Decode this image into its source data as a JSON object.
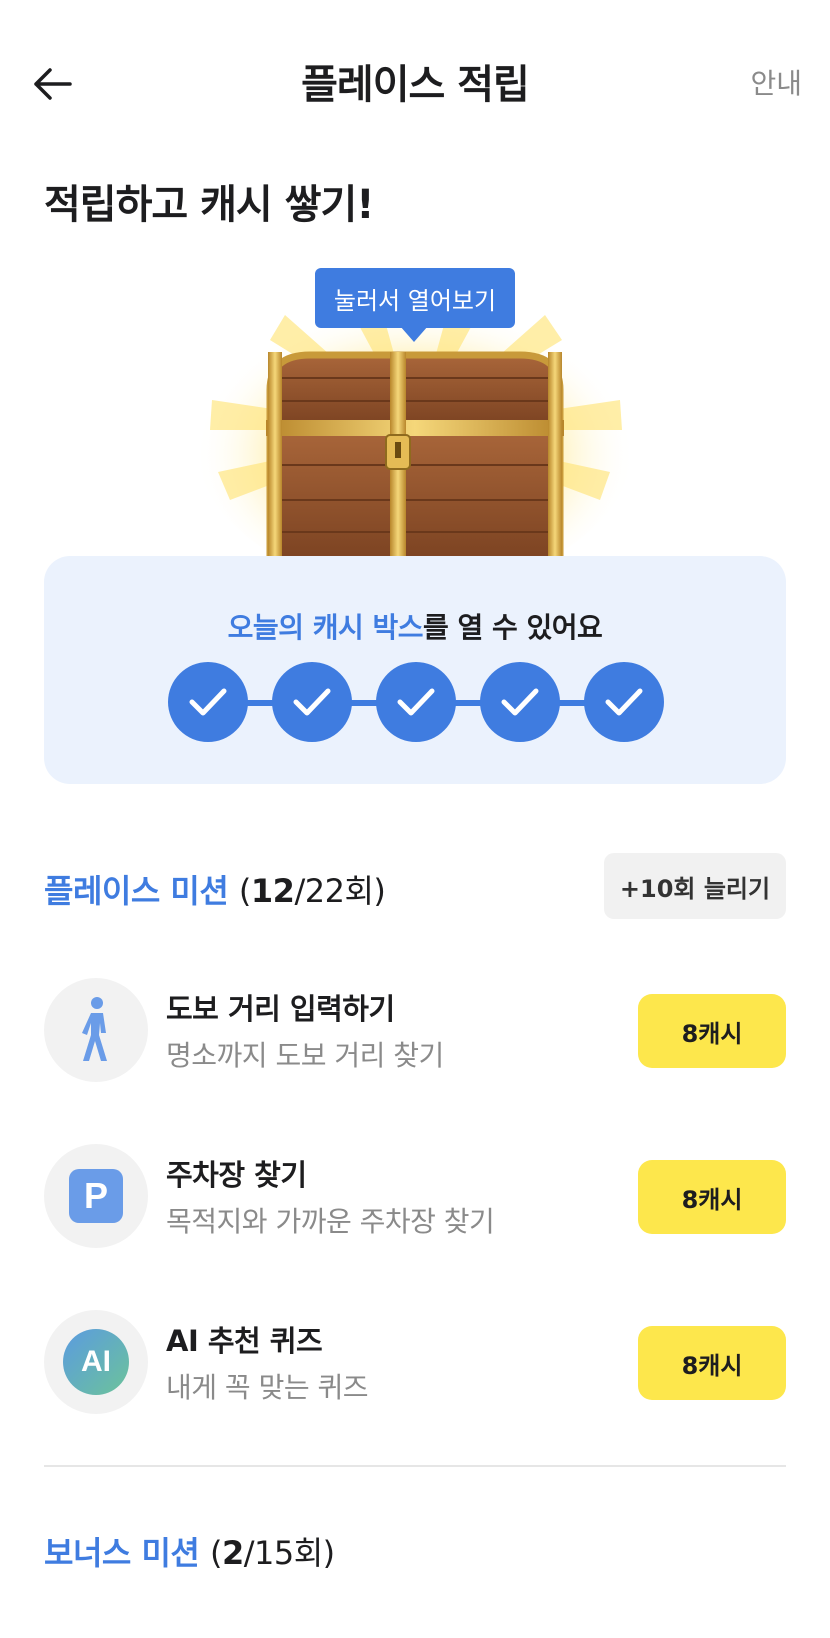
{
  "header": {
    "title": "플레이스 적립",
    "info_label": "안내"
  },
  "subtitle": "적립하고 캐시 쌓기!",
  "chest": {
    "tooltip": "눌러서 열어보기"
  },
  "cash_box": {
    "highlight": "오늘의 캐시 박스",
    "rest": "를 열 수 있어요",
    "steps_completed": 5,
    "steps_total": 5
  },
  "place_mission": {
    "title": "플레이스 미션",
    "count_open": "(",
    "count_done": "12",
    "count_total": "/22회)",
    "extend_label": "+10회 늘리기",
    "items": [
      {
        "title": "도보 거리 입력하기",
        "desc": "명소까지 도보 거리 찾기",
        "reward": "8캐시",
        "icon": "walking-person-icon"
      },
      {
        "title": "주차장 찾기",
        "desc": "목적지와 가까운 주차장 찾기",
        "reward": "8캐시",
        "icon": "parking-icon"
      },
      {
        "title": "AI 추천 퀴즈",
        "desc": "내게 꼭 맞는 퀴즈",
        "reward": "8캐시",
        "icon": "ai-icon"
      }
    ]
  },
  "bonus_mission": {
    "title": "보너스 미션",
    "count_open": "(",
    "count_done": "2",
    "count_total": "/15회)"
  },
  "icons": {
    "ai_label": "AI",
    "parking_label": "P"
  },
  "colors": {
    "accent": "#3f7ce0",
    "reward": "#fde74c",
    "card_bg": "#ebf2fd"
  }
}
